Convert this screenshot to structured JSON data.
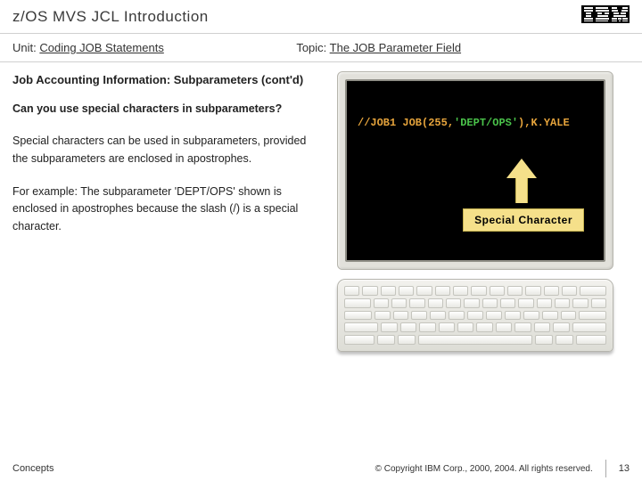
{
  "header": {
    "title": "z/OS MVS JCL Introduction",
    "logo_alt": "IBM"
  },
  "subheader": {
    "unit_label": "Unit:",
    "unit_value": "Coding JOB Statements",
    "topic_label": "Topic:",
    "topic_value": "The JOB Parameter Field"
  },
  "content": {
    "section_title": "Job Accounting Information: Subparameters (cont'd)",
    "question": "Can you use special characters in subparameters?",
    "para1": "Special characters can be used in subparameters, provided the subparameters are enclosed in apostrophes.",
    "para2": "For example: The subparameter 'DEPT/OPS' shown is enclosed in apostrophes because the slash (/) is a special character."
  },
  "screen": {
    "code_p1": "//JOB1 JOB(255,",
    "code_highlight": "'DEPT/OPS'",
    "code_p2": "),K.YALE",
    "callout_label": "Special Character"
  },
  "footer": {
    "left": "Concepts",
    "copyright": "© Copyright IBM Corp., 2000, 2004. All rights reserved.",
    "page_number": "13"
  }
}
